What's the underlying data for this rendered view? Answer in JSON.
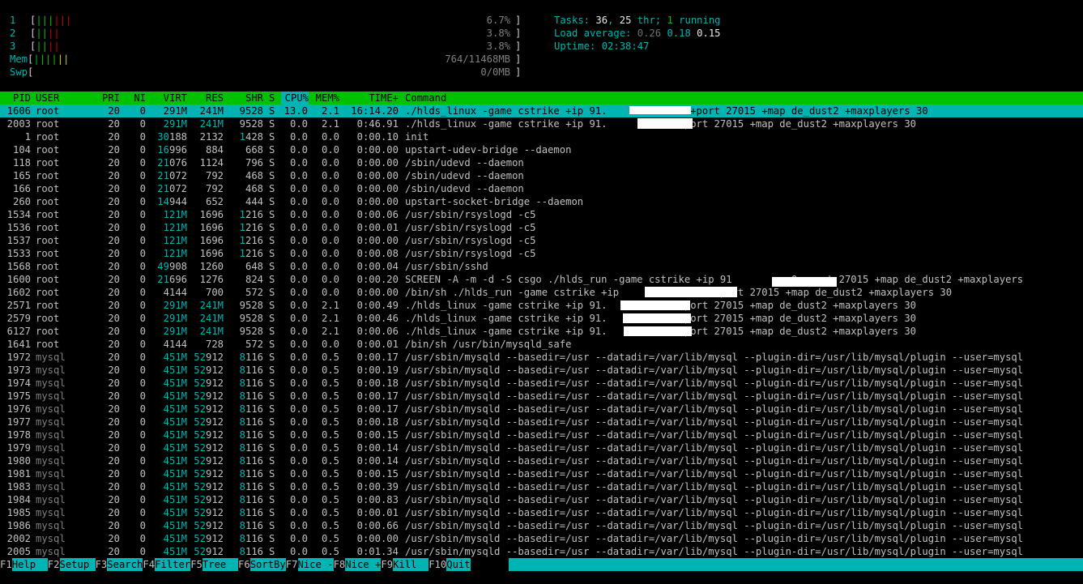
{
  "meters": {
    "cpus": [
      {
        "label": "1",
        "bars": "||||||",
        "value": "6.7%"
      },
      {
        "label": "2",
        "bars": "||||",
        "value": "3.8%"
      },
      {
        "label": "3",
        "bars": "||||",
        "value": "3.8%"
      }
    ],
    "mem": {
      "label": "Mem",
      "bars": "||||||",
      "value": "764/11468MB"
    },
    "swp": {
      "label": "Swp",
      "bars": "",
      "value": "0/0MB"
    }
  },
  "info": {
    "tasks_label": "Tasks: ",
    "tasks": "36",
    "thr": "25",
    "thr_suffix": " thr; ",
    "running": "1",
    "running_suffix": " running",
    "load_label": "Load average: ",
    "load1": "0.26",
    "load5": "0.18",
    "load15": "0.15",
    "uptime_label": "Uptime: ",
    "uptime": "02:38:47"
  },
  "columns": [
    "PID",
    "USER",
    "PRI",
    "NI",
    "VIRT",
    "RES",
    "SHR",
    "S",
    "CPU%",
    "MEM%",
    "TIME+",
    "Command"
  ],
  "processes": [
    {
      "pid": "1606",
      "user": "root",
      "pri": "20",
      "ni": "0",
      "virt": "291M",
      "res": "241M",
      "shr": "9528",
      "s": "S",
      "cpu": "13.0",
      "mem": "2.1",
      "time": "16:14.20",
      "cmd": "./hlds_linux -game cstrike +ip 91.          .20 +port 27015 +map de_dust2 +maxplayers 30"
    },
    {
      "pid": "2003",
      "user": "root",
      "pri": "20",
      "ni": "0",
      "virt": "291M",
      "res": "241M",
      "shr": "9528",
      "s": "S",
      "cpu": "0.0",
      "mem": "2.1",
      "time": "0:46.91",
      "cmd": "./hlds_linux -game cstrike +ip 91.            +port 27015 +map de_dust2 +maxplayers 30"
    },
    {
      "pid": "1",
      "user": "root",
      "pri": "20",
      "ni": "0",
      "virt": "30188",
      "res": "2132",
      "shr": "1428",
      "s": "S",
      "cpu": "0.0",
      "mem": "0.0",
      "time": "0:00.10",
      "cmd": "init"
    },
    {
      "pid": "104",
      "user": "root",
      "pri": "20",
      "ni": "0",
      "virt": "16996",
      "res": "884",
      "shr": "668",
      "s": "S",
      "cpu": "0.0",
      "mem": "0.0",
      "time": "0:00.00",
      "cmd": "upstart-udev-bridge --daemon"
    },
    {
      "pid": "118",
      "user": "root",
      "pri": "20",
      "ni": "0",
      "virt": "21076",
      "res": "1124",
      "shr": "796",
      "s": "S",
      "cpu": "0.0",
      "mem": "0.0",
      "time": "0:00.00",
      "cmd": "/sbin/udevd --daemon"
    },
    {
      "pid": "165",
      "user": "root",
      "pri": "20",
      "ni": "0",
      "virt": "21072",
      "res": "792",
      "shr": "468",
      "s": "S",
      "cpu": "0.0",
      "mem": "0.0",
      "time": "0:00.00",
      "cmd": "/sbin/udevd --daemon"
    },
    {
      "pid": "166",
      "user": "root",
      "pri": "20",
      "ni": "0",
      "virt": "21072",
      "res": "792",
      "shr": "468",
      "s": "S",
      "cpu": "0.0",
      "mem": "0.0",
      "time": "0:00.00",
      "cmd": "/sbin/udevd --daemon"
    },
    {
      "pid": "260",
      "user": "root",
      "pri": "20",
      "ni": "0",
      "virt": "14944",
      "res": "652",
      "shr": "444",
      "s": "S",
      "cpu": "0.0",
      "mem": "0.0",
      "time": "0:00.00",
      "cmd": "upstart-socket-bridge --daemon"
    },
    {
      "pid": "1534",
      "user": "root",
      "pri": "20",
      "ni": "0",
      "virt": "121M",
      "res": "1696",
      "shr": "1216",
      "s": "S",
      "cpu": "0.0",
      "mem": "0.0",
      "time": "0:00.06",
      "cmd": "/usr/sbin/rsyslogd -c5"
    },
    {
      "pid": "1536",
      "user": "root",
      "pri": "20",
      "ni": "0",
      "virt": "121M",
      "res": "1696",
      "shr": "1216",
      "s": "S",
      "cpu": "0.0",
      "mem": "0.0",
      "time": "0:00.01",
      "cmd": "/usr/sbin/rsyslogd -c5"
    },
    {
      "pid": "1537",
      "user": "root",
      "pri": "20",
      "ni": "0",
      "virt": "121M",
      "res": "1696",
      "shr": "1216",
      "s": "S",
      "cpu": "0.0",
      "mem": "0.0",
      "time": "0:00.00",
      "cmd": "/usr/sbin/rsyslogd -c5"
    },
    {
      "pid": "1533",
      "user": "root",
      "pri": "20",
      "ni": "0",
      "virt": "121M",
      "res": "1696",
      "shr": "1216",
      "s": "S",
      "cpu": "0.0",
      "mem": "0.0",
      "time": "0:00.08",
      "cmd": "/usr/sbin/rsyslogd -c5"
    },
    {
      "pid": "1568",
      "user": "root",
      "pri": "20",
      "ni": "0",
      "virt": "49908",
      "res": "1260",
      "shr": "648",
      "s": "S",
      "cpu": "0.0",
      "mem": "0.0",
      "time": "0:00.04",
      "cmd": "/usr/sbin/sshd"
    },
    {
      "pid": "1600",
      "user": "root",
      "pri": "20",
      "ni": "0",
      "virt": "21696",
      "res": "1276",
      "shr": "824",
      "s": "S",
      "cpu": "0.0",
      "mem": "0.0",
      "time": "0:00.20",
      "cmd": "SCREEN -A -m -d -S csgo ./hlds_run -game cstrike +ip 91          0 +port 27015 +map de_dust2 +maxplayers"
    },
    {
      "pid": "1602",
      "user": "root",
      "pri": "20",
      "ni": "0",
      "virt": "4144",
      "res": "700",
      "shr": "572",
      "s": "S",
      "cpu": "0.0",
      "mem": "0.0",
      "time": "0:00.00",
      "cmd": "/bin/sh ./hlds_run -game cstrike +ip                +port 27015 +map de_dust2 +maxplayers 30"
    },
    {
      "pid": "2571",
      "user": "root",
      "pri": "20",
      "ni": "0",
      "virt": "291M",
      "res": "241M",
      "shr": "9528",
      "s": "S",
      "cpu": "0.0",
      "mem": "2.1",
      "time": "0:00.49",
      "cmd": "./hlds_linux -game cstrike +ip 91.            +port 27015 +map de_dust2 +maxplayers 30"
    },
    {
      "pid": "2579",
      "user": "root",
      "pri": "20",
      "ni": "0",
      "virt": "291M",
      "res": "241M",
      "shr": "9528",
      "s": "S",
      "cpu": "0.0",
      "mem": "2.1",
      "time": "0:00.46",
      "cmd": "./hlds_linux -game cstrike +ip 91.            +port 27015 +map de_dust2 +maxplayers 30"
    },
    {
      "pid": "6127",
      "user": "root",
      "pri": "20",
      "ni": "0",
      "virt": "291M",
      "res": "241M",
      "shr": "9528",
      "s": "S",
      "cpu": "0.0",
      "mem": "2.1",
      "time": "0:00.06",
      "cmd": "./hlds_linux -game cstrike +ip 91.            +port 27015 +map de_dust2 +maxplayers 30"
    },
    {
      "pid": "1641",
      "user": "root",
      "pri": "20",
      "ni": "0",
      "virt": "4144",
      "res": "728",
      "shr": "572",
      "s": "S",
      "cpu": "0.0",
      "mem": "0.0",
      "time": "0:00.01",
      "cmd": "/bin/sh /usr/bin/mysqld_safe"
    },
    {
      "pid": "1972",
      "user": "mysql",
      "pri": "20",
      "ni": "0",
      "virt": "451M",
      "res": "52912",
      "shr": "8116",
      "s": "S",
      "cpu": "0.0",
      "mem": "0.5",
      "time": "0:00.17",
      "cmd": "/usr/sbin/mysqld --basedir=/usr --datadir=/var/lib/mysql --plugin-dir=/usr/lib/mysql/plugin --user=mysql"
    },
    {
      "pid": "1973",
      "user": "mysql",
      "pri": "20",
      "ni": "0",
      "virt": "451M",
      "res": "52912",
      "shr": "8116",
      "s": "S",
      "cpu": "0.0",
      "mem": "0.5",
      "time": "0:00.19",
      "cmd": "/usr/sbin/mysqld --basedir=/usr --datadir=/var/lib/mysql --plugin-dir=/usr/lib/mysql/plugin --user=mysql"
    },
    {
      "pid": "1974",
      "user": "mysql",
      "pri": "20",
      "ni": "0",
      "virt": "451M",
      "res": "52912",
      "shr": "8116",
      "s": "S",
      "cpu": "0.0",
      "mem": "0.5",
      "time": "0:00.18",
      "cmd": "/usr/sbin/mysqld --basedir=/usr --datadir=/var/lib/mysql --plugin-dir=/usr/lib/mysql/plugin --user=mysql"
    },
    {
      "pid": "1975",
      "user": "mysql",
      "pri": "20",
      "ni": "0",
      "virt": "451M",
      "res": "52912",
      "shr": "8116",
      "s": "S",
      "cpu": "0.0",
      "mem": "0.5",
      "time": "0:00.17",
      "cmd": "/usr/sbin/mysqld --basedir=/usr --datadir=/var/lib/mysql --plugin-dir=/usr/lib/mysql/plugin --user=mysql"
    },
    {
      "pid": "1976",
      "user": "mysql",
      "pri": "20",
      "ni": "0",
      "virt": "451M",
      "res": "52912",
      "shr": "8116",
      "s": "S",
      "cpu": "0.0",
      "mem": "0.5",
      "time": "0:00.17",
      "cmd": "/usr/sbin/mysqld --basedir=/usr --datadir=/var/lib/mysql --plugin-dir=/usr/lib/mysql/plugin --user=mysql"
    },
    {
      "pid": "1977",
      "user": "mysql",
      "pri": "20",
      "ni": "0",
      "virt": "451M",
      "res": "52912",
      "shr": "8116",
      "s": "S",
      "cpu": "0.0",
      "mem": "0.5",
      "time": "0:00.18",
      "cmd": "/usr/sbin/mysqld --basedir=/usr --datadir=/var/lib/mysql --plugin-dir=/usr/lib/mysql/plugin --user=mysql"
    },
    {
      "pid": "1978",
      "user": "mysql",
      "pri": "20",
      "ni": "0",
      "virt": "451M",
      "res": "52912",
      "shr": "8116",
      "s": "S",
      "cpu": "0.0",
      "mem": "0.5",
      "time": "0:00.15",
      "cmd": "/usr/sbin/mysqld --basedir=/usr --datadir=/var/lib/mysql --plugin-dir=/usr/lib/mysql/plugin --user=mysql"
    },
    {
      "pid": "1979",
      "user": "mysql",
      "pri": "20",
      "ni": "0",
      "virt": "451M",
      "res": "52912",
      "shr": "8116",
      "s": "S",
      "cpu": "0.0",
      "mem": "0.5",
      "time": "0:00.14",
      "cmd": "/usr/sbin/mysqld --basedir=/usr --datadir=/var/lib/mysql --plugin-dir=/usr/lib/mysql/plugin --user=mysql"
    },
    {
      "pid": "1980",
      "user": "mysql",
      "pri": "20",
      "ni": "0",
      "virt": "451M",
      "res": "52912",
      "shr": "8116",
      "s": "S",
      "cpu": "0.0",
      "mem": "0.5",
      "time": "0:00.14",
      "cmd": "/usr/sbin/mysqld --basedir=/usr --datadir=/var/lib/mysql --plugin-dir=/usr/lib/mysql/plugin --user=mysql"
    },
    {
      "pid": "1981",
      "user": "mysql",
      "pri": "20",
      "ni": "0",
      "virt": "451M",
      "res": "52912",
      "shr": "8116",
      "s": "S",
      "cpu": "0.0",
      "mem": "0.5",
      "time": "0:00.15",
      "cmd": "/usr/sbin/mysqld --basedir=/usr --datadir=/var/lib/mysql --plugin-dir=/usr/lib/mysql/plugin --user=mysql"
    },
    {
      "pid": "1983",
      "user": "mysql",
      "pri": "20",
      "ni": "0",
      "virt": "451M",
      "res": "52912",
      "shr": "8116",
      "s": "S",
      "cpu": "0.0",
      "mem": "0.5",
      "time": "0:00.39",
      "cmd": "/usr/sbin/mysqld --basedir=/usr --datadir=/var/lib/mysql --plugin-dir=/usr/lib/mysql/plugin --user=mysql"
    },
    {
      "pid": "1984",
      "user": "mysql",
      "pri": "20",
      "ni": "0",
      "virt": "451M",
      "res": "52912",
      "shr": "8116",
      "s": "S",
      "cpu": "0.0",
      "mem": "0.5",
      "time": "0:00.83",
      "cmd": "/usr/sbin/mysqld --basedir=/usr --datadir=/var/lib/mysql --plugin-dir=/usr/lib/mysql/plugin --user=mysql"
    },
    {
      "pid": "1985",
      "user": "mysql",
      "pri": "20",
      "ni": "0",
      "virt": "451M",
      "res": "52912",
      "shr": "8116",
      "s": "S",
      "cpu": "0.0",
      "mem": "0.5",
      "time": "0:00.01",
      "cmd": "/usr/sbin/mysqld --basedir=/usr --datadir=/var/lib/mysql --plugin-dir=/usr/lib/mysql/plugin --user=mysql"
    },
    {
      "pid": "1986",
      "user": "mysql",
      "pri": "20",
      "ni": "0",
      "virt": "451M",
      "res": "52912",
      "shr": "8116",
      "s": "S",
      "cpu": "0.0",
      "mem": "0.5",
      "time": "0:00.66",
      "cmd": "/usr/sbin/mysqld --basedir=/usr --datadir=/var/lib/mysql --plugin-dir=/usr/lib/mysql/plugin --user=mysql"
    },
    {
      "pid": "2002",
      "user": "mysql",
      "pri": "20",
      "ni": "0",
      "virt": "451M",
      "res": "52912",
      "shr": "8116",
      "s": "S",
      "cpu": "0.0",
      "mem": "0.5",
      "time": "0:00.00",
      "cmd": "/usr/sbin/mysqld --basedir=/usr --datadir=/var/lib/mysql --plugin-dir=/usr/lib/mysql/plugin --user=mysql"
    },
    {
      "pid": "2005",
      "user": "mysql",
      "pri": "20",
      "ni": "0",
      "virt": "451M",
      "res": "52912",
      "shr": "8116",
      "s": "S",
      "cpu": "0.0",
      "mem": "0.5",
      "time": "0:01.34",
      "cmd": "/usr/sbin/mysqld --basedir=/usr --datadir=/var/lib/mysql --plugin-dir=/usr/lib/mysql/plugin --user=mysql"
    }
  ],
  "footer": [
    {
      "key": "F1",
      "label": "Help  "
    },
    {
      "key": "F2",
      "label": "Setup "
    },
    {
      "key": "F3",
      "label": "Search"
    },
    {
      "key": "F4",
      "label": "Filter"
    },
    {
      "key": "F5",
      "label": "Tree  "
    },
    {
      "key": "F6",
      "label": "SortBy"
    },
    {
      "key": "F7",
      "label": "Nice -"
    },
    {
      "key": "F8",
      "label": "Nice +"
    },
    {
      "key": "F9",
      "label": "Kill  "
    },
    {
      "key": "F10",
      "label": "Quit"
    }
  ],
  "colors": {
    "background": "#000000",
    "header_bg": "#00c000",
    "selected_bg": "#00b4b4",
    "text_cyan": "#00b4b4",
    "bar_green": "#00c000",
    "bar_red": "#c00000",
    "bar_yellow": "#c8c800"
  }
}
